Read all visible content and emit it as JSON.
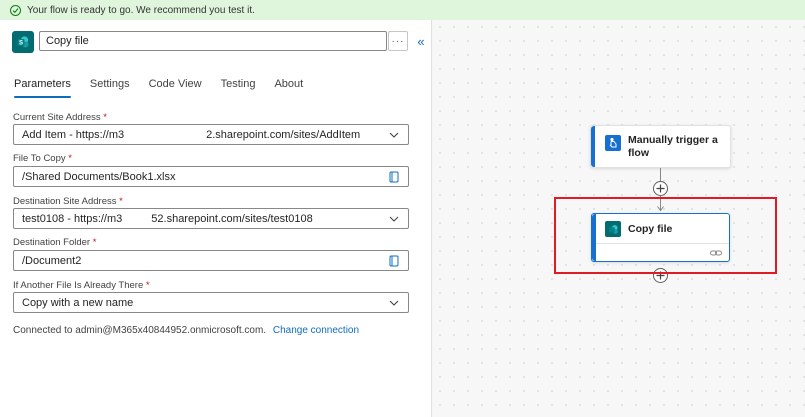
{
  "banner": {
    "message": "Your flow is ready to go. We recommend you test it."
  },
  "header": {
    "action_title": "Copy file",
    "more_label": "···",
    "collapse_label": "«"
  },
  "tabs": [
    {
      "label": "Parameters"
    },
    {
      "label": "Settings"
    },
    {
      "label": "Code View"
    },
    {
      "label": "Testing"
    },
    {
      "label": "About"
    }
  ],
  "fields": {
    "current_site": {
      "label": "Current Site Address",
      "required": "*",
      "value_prefix": "Add Item - https://m3",
      "value_suffix": "2.sharepoint.com/sites/AddItem"
    },
    "file_to_copy": {
      "label": "File To Copy",
      "required": "*",
      "value": "/Shared Documents/Book1.xlsx"
    },
    "destination_site": {
      "label": "Destination Site Address",
      "required": "*",
      "value_prefix": "test0108 - https://m3",
      "value_suffix": "52.sharepoint.com/sites/test0108"
    },
    "destination_folder": {
      "label": "Destination Folder",
      "required": "*",
      "value": "/Document2"
    },
    "if_exists": {
      "label": "If Another File Is Already There",
      "required": "*",
      "value": "Copy with a new name"
    }
  },
  "connection": {
    "text": "Connected to admin@M365x40844952.onmicrosoft.com.",
    "change_label": "Change connection"
  },
  "canvas": {
    "trigger_node": {
      "label_line1": "Manually trigger a",
      "label_line2": "flow"
    },
    "action_node": {
      "label": "Copy file"
    }
  },
  "colors": {
    "accent": "#0f6cbd",
    "sharepoint": "#036c70",
    "success_bg": "#dff6dd",
    "highlight": "#e01b24"
  }
}
